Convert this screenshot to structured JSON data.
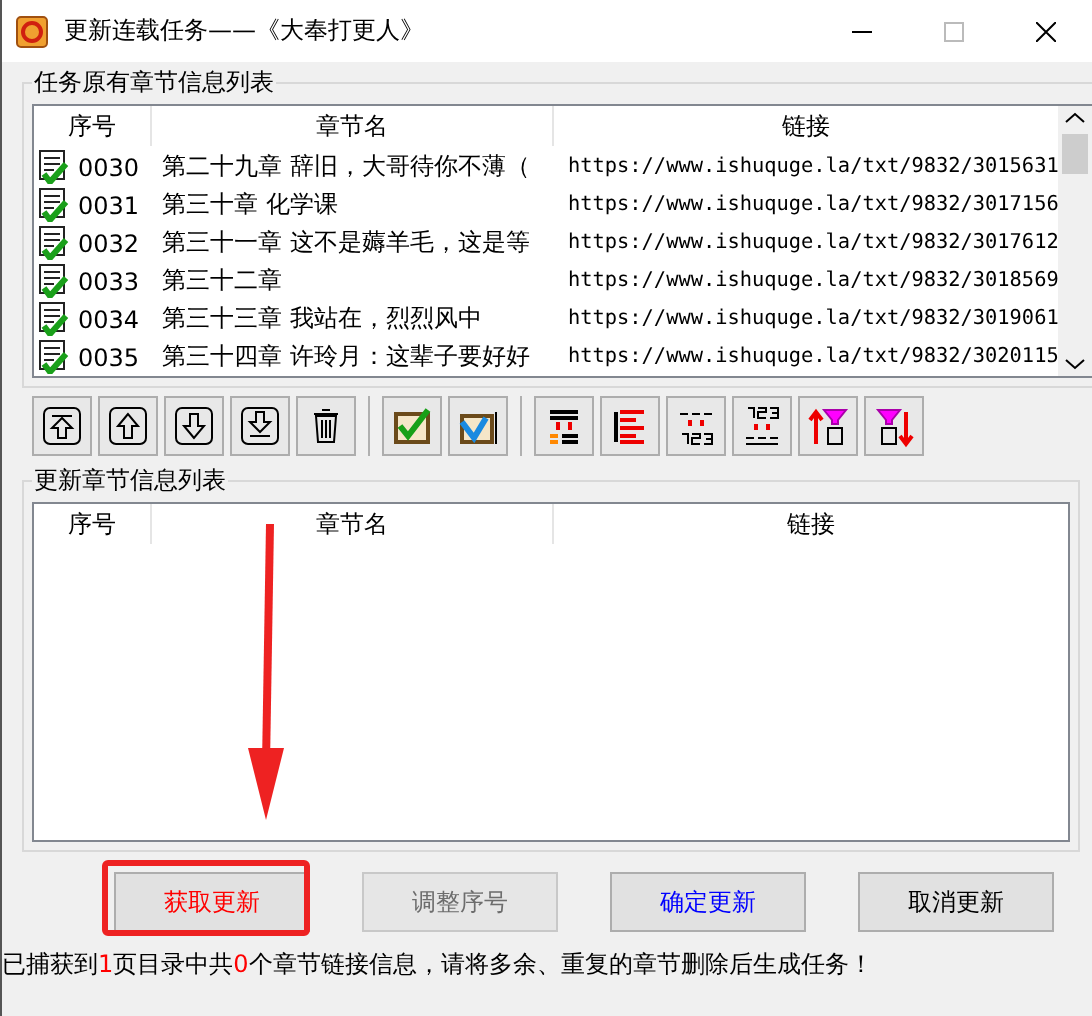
{
  "window": {
    "title": "更新连载任务——《大奉打更人》"
  },
  "original_group": {
    "title": "任务原有章节信息列表",
    "columns": [
      "序号",
      "章节名",
      "链接"
    ],
    "rows": [
      {
        "seq": "0030",
        "name": "第二十九章 辞旧，大哥待你不薄（",
        "link": "https://www.ishuquge.la/txt/9832/3015631",
        "checked": true
      },
      {
        "seq": "0031",
        "name": "第三十章 化学课",
        "link": "https://www.ishuquge.la/txt/9832/3017156",
        "checked": true
      },
      {
        "seq": "0032",
        "name": "第三十一章 这不是薅羊毛，这是等",
        "link": "https://www.ishuquge.la/txt/9832/3017612",
        "checked": true
      },
      {
        "seq": "0033",
        "name": "第三十二章",
        "link": "https://www.ishuquge.la/txt/9832/3018569",
        "checked": true
      },
      {
        "seq": "0034",
        "name": "第三十三章 我站在，烈烈风中",
        "link": "https://www.ishuquge.la/txt/9832/3019061",
        "checked": true
      },
      {
        "seq": "0035",
        "name": "第三十四章 许玲月：这辈子要好好",
        "link": "https://www.ishuquge.la/txt/9832/3020115",
        "checked": true
      }
    ]
  },
  "update_group": {
    "title": "更新章节信息列表",
    "columns": [
      "序号",
      "章节名",
      "链接"
    ]
  },
  "buttons": [
    {
      "label": "获取更新",
      "color": "#ff0000",
      "disabled": false,
      "highlighted": true
    },
    {
      "label": "调整序号",
      "color": "#6d6d6d",
      "disabled": true,
      "highlighted": false
    },
    {
      "label": "确定更新",
      "color": "#0000ff",
      "disabled": false,
      "highlighted": false
    },
    {
      "label": "取消更新",
      "color": "#000000",
      "disabled": false,
      "highlighted": false
    }
  ],
  "status": [
    {
      "text": "已捕获到",
      "highlight": false
    },
    {
      "text": "1",
      "highlight": true
    },
    {
      "text": "页目录中共",
      "highlight": false
    },
    {
      "text": "0",
      "highlight": true
    },
    {
      "text": "个章节链接信息，请将多余、重复的章节删除后生成任务！",
      "highlight": false
    }
  ]
}
